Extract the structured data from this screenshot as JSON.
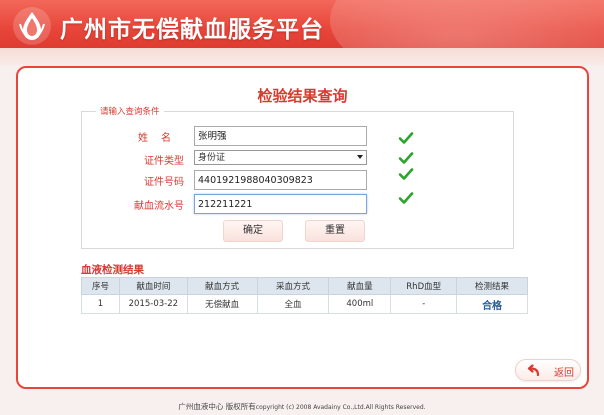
{
  "header": {
    "title": "广州市无偿献血服务平台"
  },
  "page": {
    "title": "检验结果查询"
  },
  "form": {
    "legend": "请输入查询条件",
    "name_label": "姓名",
    "name_value": "张明强",
    "id_type_label": "证件类型",
    "id_type_value": "身份证",
    "id_number_label": "证件号码",
    "id_number_value": "440192198804030982​3",
    "serial_label": "献血流水号",
    "serial_value": "212211221",
    "confirm_label": "确定",
    "reset_label": "重置"
  },
  "results": {
    "title": "血液检测结果",
    "columns": [
      "序号",
      "献血时间",
      "献血方式",
      "采血方式",
      "献血量",
      "RhD血型",
      "检测结果"
    ],
    "rows": [
      [
        "1",
        "2015-03-22",
        "无偿献血",
        "全血",
        "400ml",
        "-",
        "合格"
      ]
    ]
  },
  "nav": {
    "back_label": "返回"
  },
  "footer": {
    "org": "广州血液中心",
    "rights": "版权所有",
    "copyright": "copyright (c) 2008 Avadainy Co.,Ltd.All Rights Reserved."
  },
  "colors": {
    "brand": "#e8463a",
    "accent_text": "#d83a31",
    "check": "#2aa52a",
    "pass": "#2a5d9a"
  },
  "icons": {
    "logo": "blood-drop-logo-icon",
    "valid": "checkmark-icon",
    "back": "back-arrow-icon"
  }
}
